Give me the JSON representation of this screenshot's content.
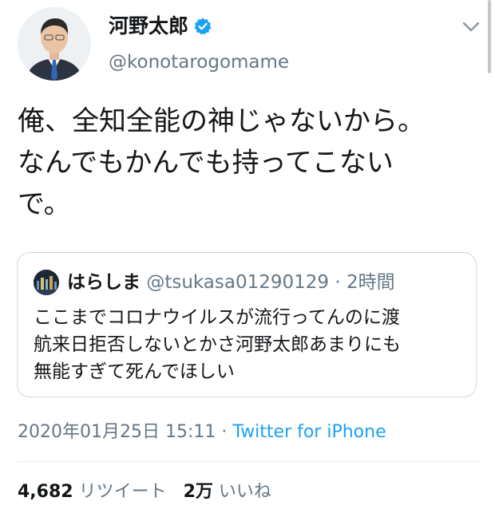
{
  "tweet": {
    "author": {
      "name": "河野太郎",
      "handle": "@konotarogomame",
      "verified": true,
      "avatar": "profile-photo"
    },
    "text_lines": [
      "俺、全知全能の神じゃないから。",
      "なんでもかんでも持ってこない",
      "で。"
    ],
    "quoted": {
      "name": "はらしま",
      "handle": "@tsukasa01290129",
      "separator": "·",
      "time": "2時間",
      "text_lines": [
        "ここまでコロナウイルスが流行ってんのに渡",
        "航来日拒否しないとかさ河野太郎あまりにも",
        "無能すぎて死んでほしい"
      ]
    },
    "timestamp": "2020年01月25日 15:11",
    "meta_separator": "·",
    "source": "Twitter for iPhone",
    "stats": {
      "retweets_count": "4,682",
      "retweets_label": "リツイート",
      "likes_count": "2万",
      "likes_label": "いいね"
    }
  },
  "colors": {
    "accent": "#1da1f2",
    "secondary_text": "#657786",
    "primary_text": "#14171a",
    "border": "#cfd9de"
  },
  "icons": [
    "verified-badge-icon",
    "chevron-down-icon"
  ]
}
